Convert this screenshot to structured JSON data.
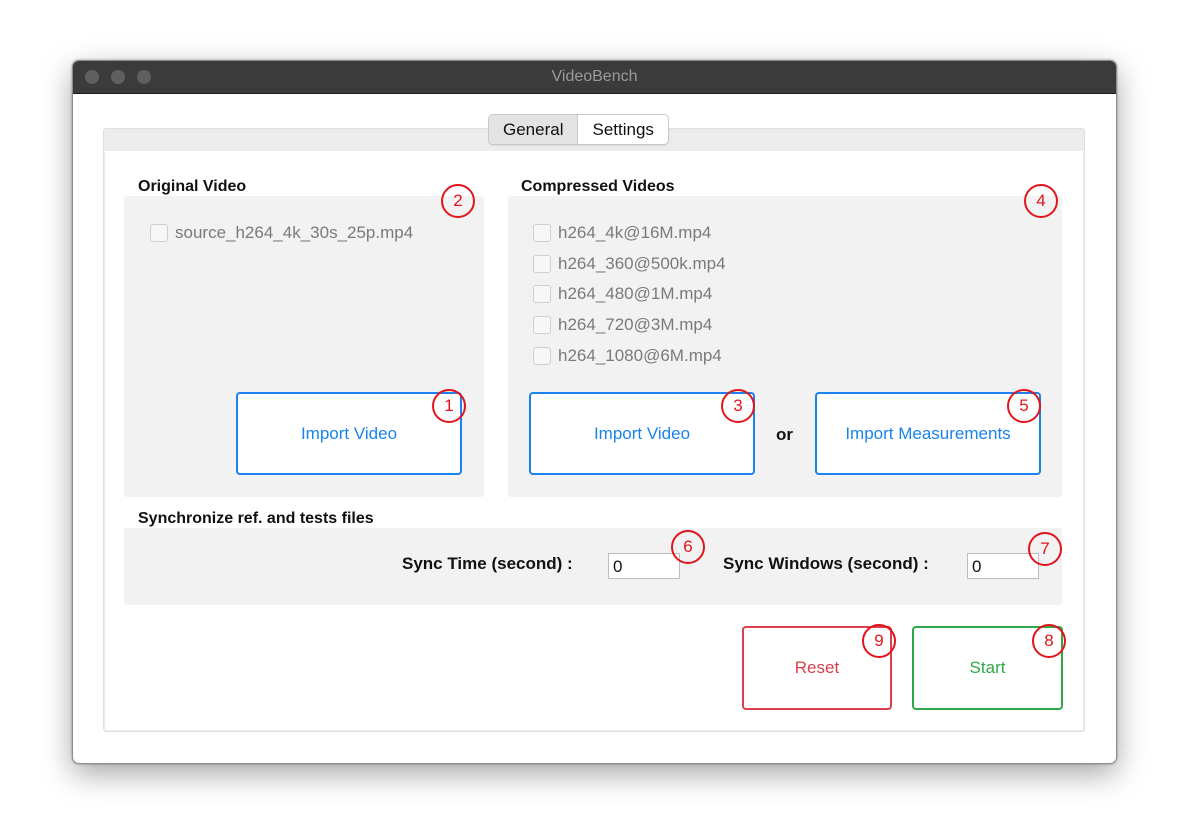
{
  "window": {
    "title": "VideoBench"
  },
  "tabs": [
    {
      "label": "General",
      "active": true
    },
    {
      "label": "Settings",
      "active": false
    }
  ],
  "original": {
    "title": "Original Video",
    "files": [
      "source_h264_4k_30s_25p.mp4"
    ],
    "import_label": "Import Video"
  },
  "compressed": {
    "title": "Compressed Videos",
    "files": [
      "h264_4k@16M.mp4",
      "h264_360@500k.mp4",
      "h264_480@1M.mp4",
      "h264_720@3M.mp4",
      "h264_1080@6M.mp4"
    ],
    "import_label": "Import Video",
    "or_label": "or",
    "import_measurements_label": "Import Measurements"
  },
  "sync": {
    "title": "Synchronize ref. and tests files",
    "time_label": "Sync Time (second) :",
    "time_value": "0",
    "window_label": "Sync Windows (second) :",
    "window_value": "0"
  },
  "actions": {
    "reset_label": "Reset",
    "start_label": "Start"
  },
  "markers": [
    "1",
    "2",
    "3",
    "4",
    "5",
    "6",
    "7",
    "8",
    "9"
  ],
  "colors": {
    "accent": "#1a83f0",
    "reset": "#d8404f",
    "start": "#2ea846",
    "marker": "#e1151b"
  }
}
